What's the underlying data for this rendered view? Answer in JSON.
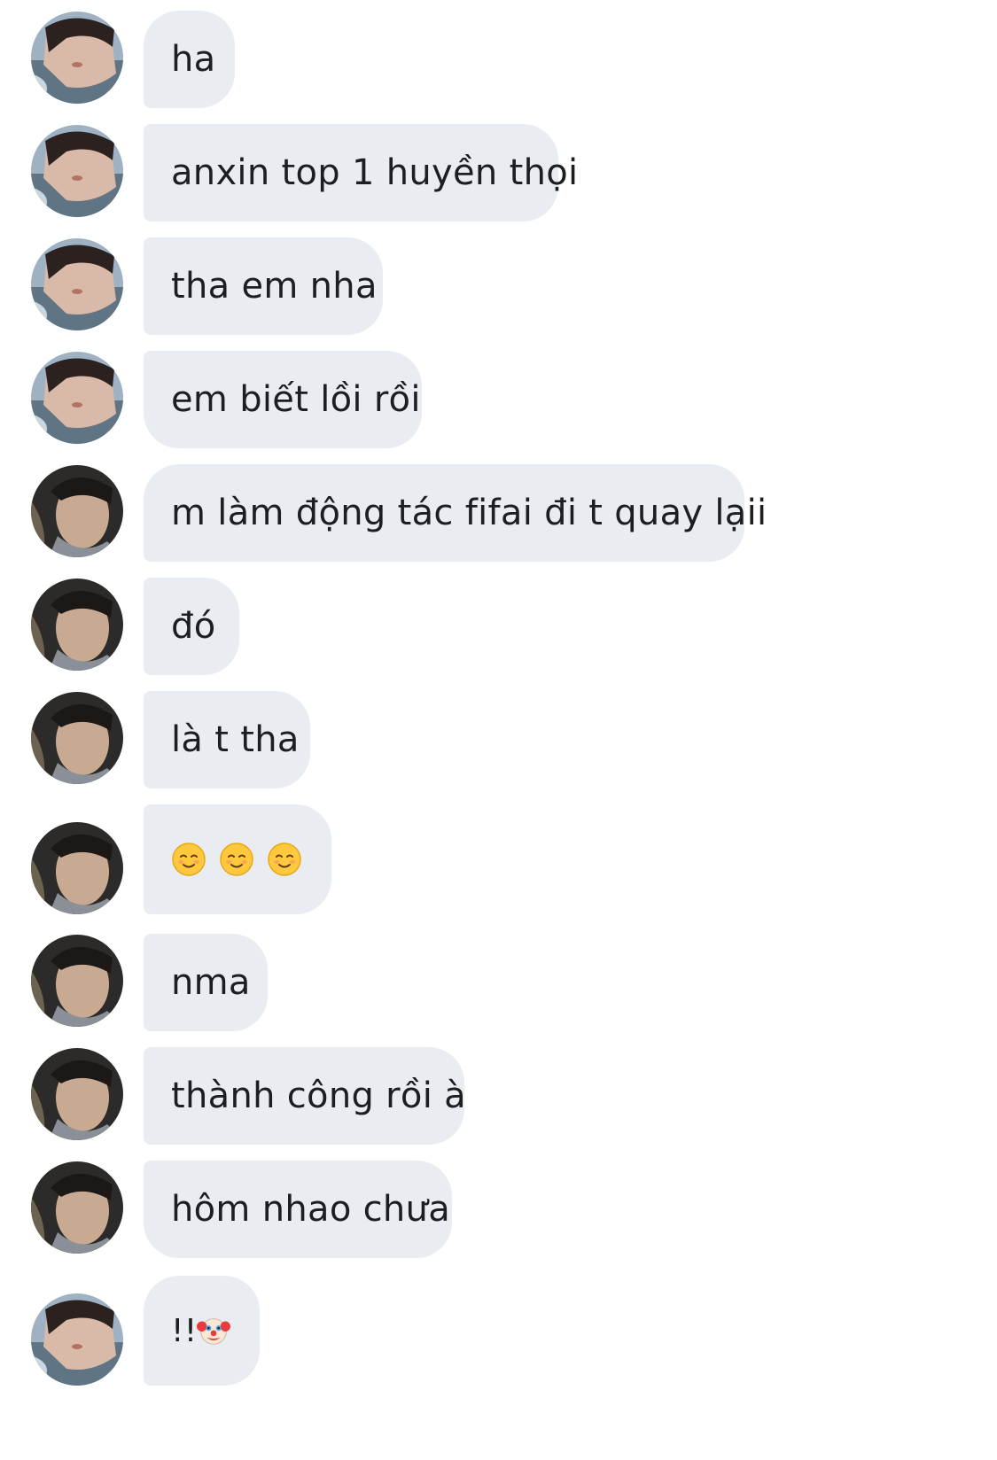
{
  "conversation": {
    "messages": [
      {
        "sender": "user-a",
        "text": "ha",
        "avatar": "avatar-a"
      },
      {
        "sender": "user-a",
        "text": "anxin top 1 huyền thọi",
        "avatar": "avatar-a"
      },
      {
        "sender": "user-a",
        "text": "tha em nha",
        "avatar": "avatar-a"
      },
      {
        "sender": "user-a",
        "text": "em biết lồi rồi",
        "avatar": "avatar-a"
      },
      {
        "sender": "user-b",
        "text": "m làm động tác fifai đi t quay lạii",
        "avatar": "avatar-b"
      },
      {
        "sender": "user-b",
        "text": "đó",
        "avatar": "avatar-b"
      },
      {
        "sender": "user-b",
        "text": "là t tha",
        "avatar": "avatar-b"
      },
      {
        "sender": "user-b",
        "emoji": [
          "smiling-face-icon",
          "smiling-face-icon",
          "smiling-face-icon"
        ],
        "avatar": "avatar-b"
      },
      {
        "sender": "user-b",
        "text": "nma",
        "avatar": "avatar-b"
      },
      {
        "sender": "user-b",
        "text": "thành công rồi à",
        "avatar": "avatar-b"
      },
      {
        "sender": "user-b",
        "text": "hôm nhao chưa",
        "avatar": "avatar-b"
      },
      {
        "sender": "user-a",
        "text": "!!",
        "trailing_emoji": "clown-face-icon",
        "avatar": "avatar-a"
      }
    ]
  },
  "colors": {
    "bubble": "#e9ecf0",
    "text": "#1c1e21",
    "background": "#ffffff"
  }
}
